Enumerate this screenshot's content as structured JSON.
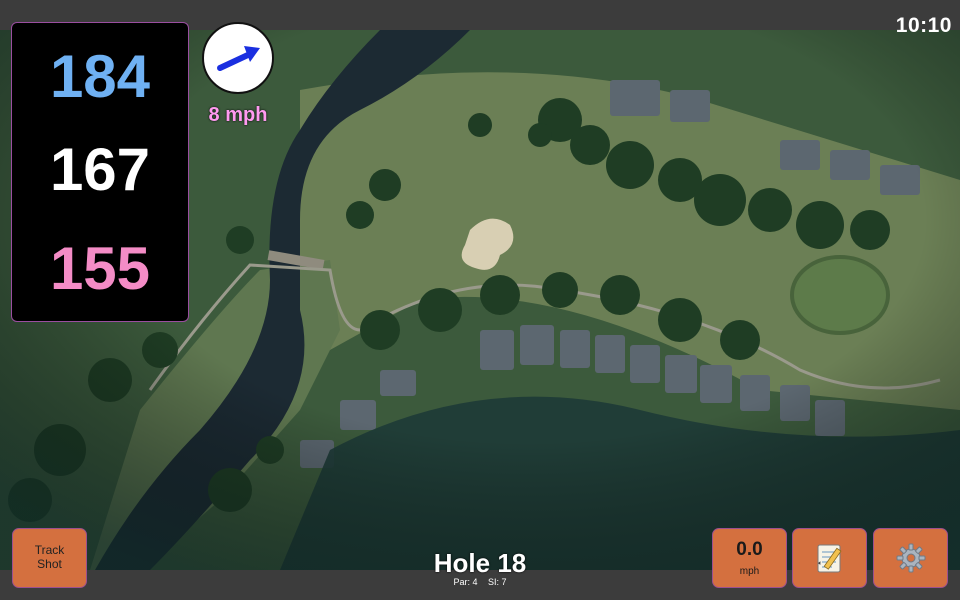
{
  "status": {
    "time": "10:10"
  },
  "yardages": {
    "back": "184",
    "middle": "167",
    "front": "155"
  },
  "wind": {
    "speed_label": "8 mph",
    "arrow_color": "#1a2fe0"
  },
  "hole": {
    "title": "Hole 18",
    "par_label": "Par: 4",
    "si_label": "SI: 7"
  },
  "buttons": {
    "track_shot_line1": "Track",
    "track_shot_line2": "Shot",
    "speed_value": "0.0",
    "speed_unit": "mph",
    "notes_icon": "notepad-icon",
    "settings_icon": "gear-icon"
  },
  "colors": {
    "back_yardage": "#6fb1f3",
    "middle_yardage": "#ffffff",
    "front_yardage": "#f48cc6",
    "button_bg": "#d4703f",
    "wind_text": "#ff9af0"
  }
}
